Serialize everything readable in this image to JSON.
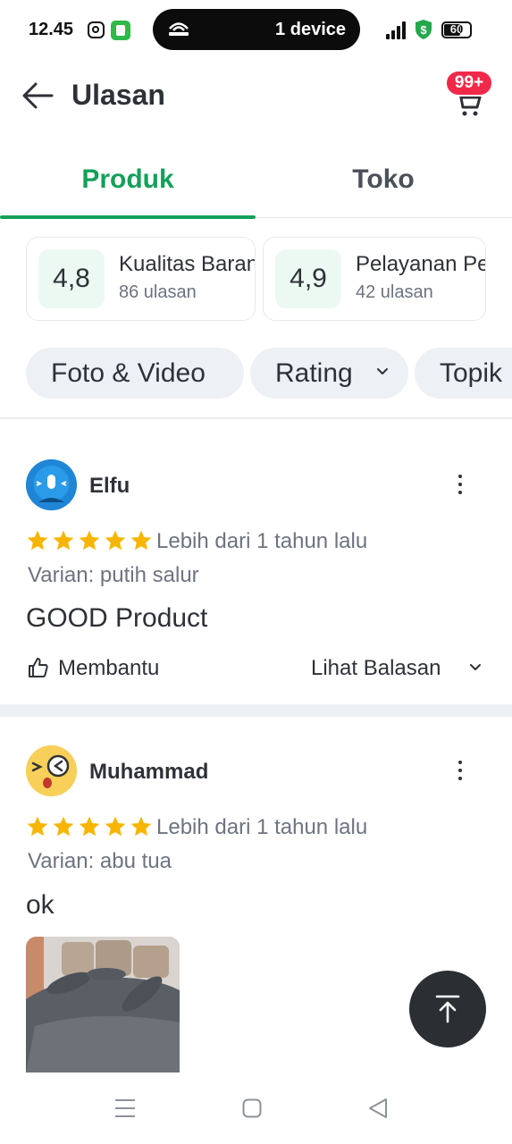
{
  "status_bar": {
    "time": "12.45",
    "pill_text": "1 device",
    "battery": "60"
  },
  "header": {
    "title": "Ulasan",
    "cart_badge": "99+"
  },
  "tabs": [
    {
      "label": "Produk",
      "active": true
    },
    {
      "label": "Toko",
      "active": false
    }
  ],
  "rating_cards": [
    {
      "score": "4,8",
      "title": "Kualitas Barang",
      "count": "86 ulasan"
    },
    {
      "score": "4,9",
      "title": "Pelayanan Penjual",
      "count": "42 ulasan"
    }
  ],
  "filters": [
    {
      "label": "Foto & Video"
    },
    {
      "label": "Rating"
    },
    {
      "label": "Topik"
    }
  ],
  "reviews": [
    {
      "user": "Elfu",
      "stars": 5,
      "time": "Lebih dari 1 tahun lalu",
      "variant": "Varian: putih salur",
      "text": "GOOD Product",
      "helpful_label": "Membantu",
      "replies_label": "Lihat Balasan"
    },
    {
      "user": "Muhammad",
      "stars": 5,
      "time": "Lebih dari 1 tahun lalu",
      "variant": "Varian: abu tua",
      "text": "ok"
    }
  ],
  "colors": {
    "accent": "#14a05a",
    "star": "#f7b500",
    "badge": "#f0294a",
    "chip_bg": "#edf0f4"
  }
}
